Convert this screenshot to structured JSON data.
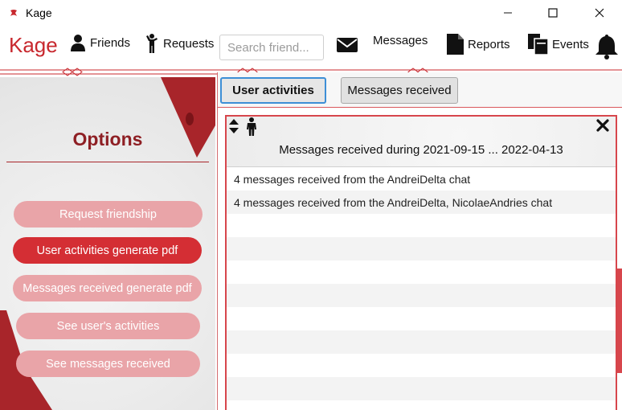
{
  "window": {
    "title": "Kage"
  },
  "toolbar": {
    "brand": "Kage",
    "friends_label": "Friends",
    "requests_label": "Requests",
    "search_placeholder": "Search friend...",
    "messages_label": "Messages",
    "reports_label": "Reports",
    "events_label": "Events"
  },
  "left": {
    "options_title": "Options",
    "buttons": [
      {
        "label": "Request friendship",
        "state": "faded"
      },
      {
        "label": "User activities generate pdf",
        "state": "active"
      },
      {
        "label": "Messages received generate pdf",
        "state": "faded"
      },
      {
        "label": "See user's activities",
        "state": "faded"
      },
      {
        "label": "See messages received",
        "state": "faded"
      }
    ]
  },
  "tabs": [
    {
      "label": "User activities",
      "active": true
    },
    {
      "label": "Messages received",
      "active": false
    }
  ],
  "panel": {
    "title": "Messages received during 2021-09-15 ... 2022-04-13",
    "rows": [
      "4 messages received from the AndreiDelta chat",
      "4 messages received from the AndreiDelta, NicolaeAndries chat"
    ]
  },
  "colors": {
    "accent": "#c8282e",
    "active_button": "#d42e34",
    "faded_button": "#e9a4a8",
    "options_title": "#8e1f24",
    "tab_focus": "#3d8fd6"
  },
  "icons": [
    "app-logo-icon",
    "minimize-icon",
    "maximize-icon",
    "close-icon",
    "user-icon",
    "person-raising-hand-icon",
    "envelope-icon",
    "document-icon",
    "copy-document-icon",
    "bell-icon",
    "sort-icon",
    "person-icon",
    "close-x-icon"
  ]
}
